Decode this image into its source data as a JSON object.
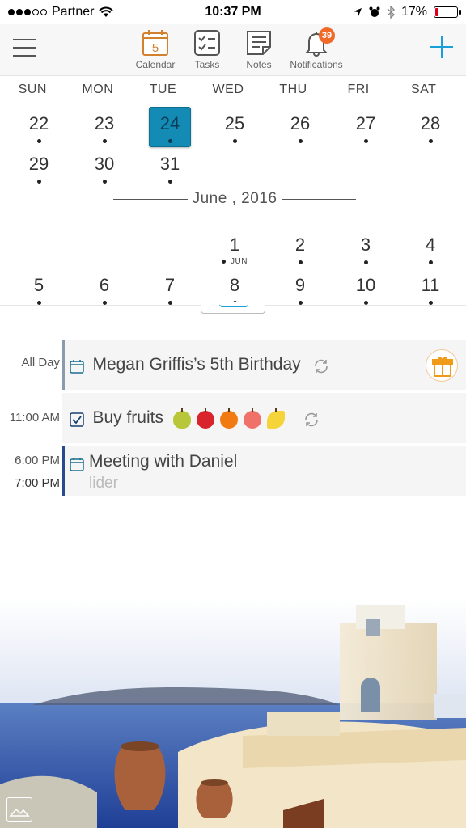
{
  "status_bar": {
    "carrier": "Partner",
    "time": "10:37 PM",
    "battery_percent": "17%",
    "battery_level": 0.17,
    "battery_color": "#e0001a",
    "icons": [
      "signal-icon",
      "wifi-icon",
      "location-icon",
      "alarm-icon",
      "bluetooth-icon",
      "battery-icon"
    ]
  },
  "toolbar": {
    "menu_icon": "hamburger-menu-icon",
    "add_icon": "plus-icon",
    "accent": "#1aa0d8",
    "tabs": [
      {
        "label": "Calendar",
        "icon": "calendar-icon",
        "icon_text": "5",
        "color": "#d2822f"
      },
      {
        "label": "Tasks",
        "icon": "checklist-icon"
      },
      {
        "label": "Notes",
        "icon": "note-icon"
      },
      {
        "label": "Notifications",
        "icon": "bell-icon",
        "badge": "39",
        "badge_color": "#f06a2a"
      }
    ]
  },
  "calendar": {
    "weekdays": [
      "SUN",
      "MON",
      "TUE",
      "WED",
      "THU",
      "FRI",
      "SAT"
    ],
    "week1": [
      "22",
      "23",
      "24",
      "25",
      "26",
      "27",
      "28"
    ],
    "week2": [
      "29",
      "30",
      "31"
    ],
    "month_label": "June , 2016",
    "week3": [
      "1",
      "2",
      "3",
      "4"
    ],
    "month_marker": "JUN",
    "week4": [
      "5",
      "6",
      "7",
      "8",
      "9",
      "10",
      "11"
    ],
    "selected_day": "24",
    "selected_color": "#138bb4"
  },
  "events": [
    {
      "time": "All Day",
      "title": "Megan Griffis’s 5th Birthday",
      "icon": "calendar-event-icon",
      "repeat": true,
      "action_icon": "gift-icon"
    },
    {
      "time": "11:00 AM",
      "title": "Buy fruits",
      "icon": "checkbox-checked-icon",
      "fruits": [
        "pear",
        "apple",
        "orange",
        "peach",
        "banana"
      ],
      "repeat": true
    },
    {
      "time_start": "6:00 PM",
      "time_end": "7:00 PM",
      "title": "Meeting with Daniel",
      "subtitle": "lider",
      "icon": "calendar-event-icon",
      "bar_color": "#2b4a8c"
    }
  ],
  "background": {
    "image_button_icon": "photo-icon"
  }
}
